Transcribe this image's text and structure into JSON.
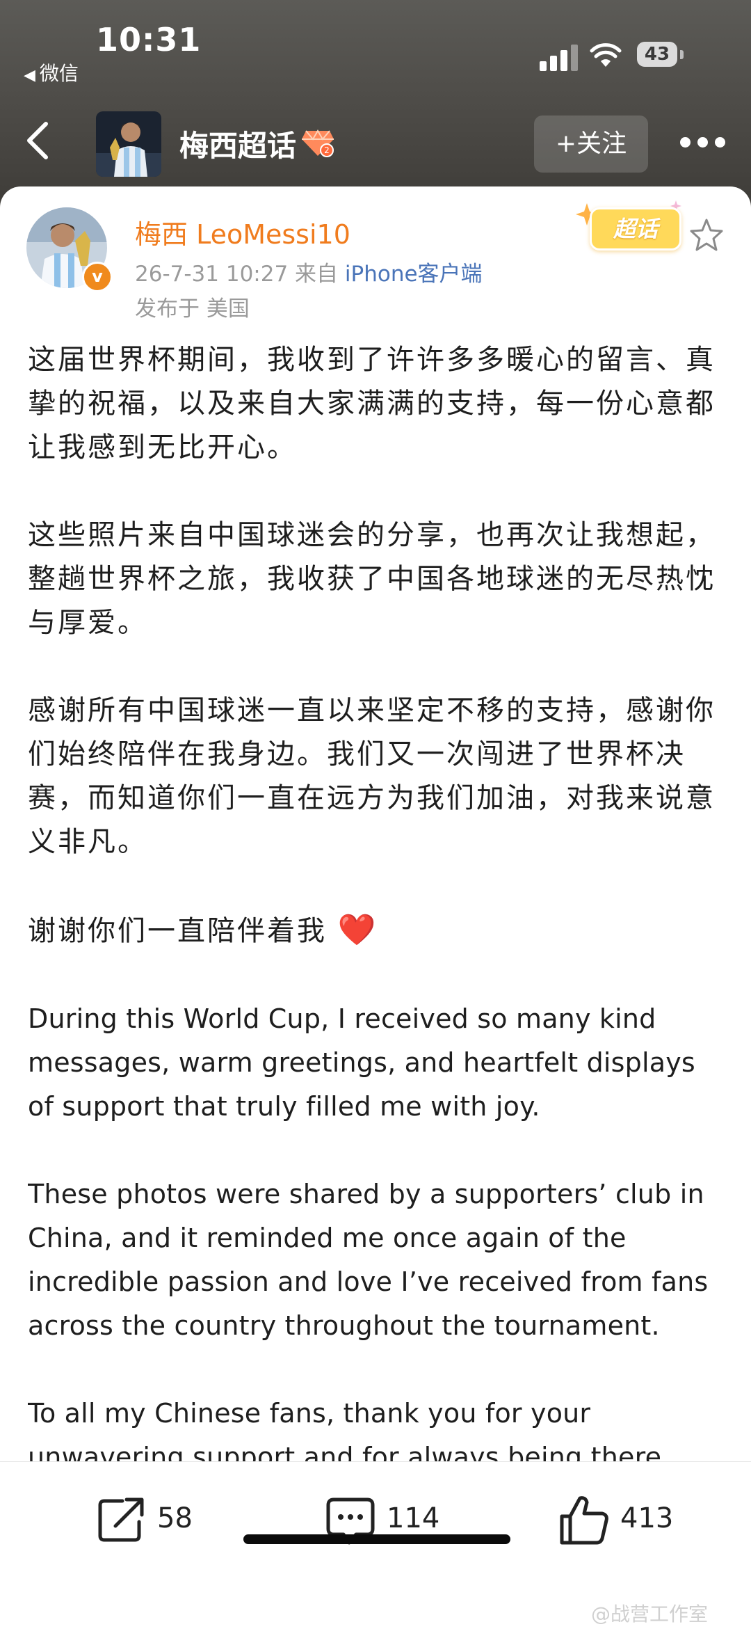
{
  "status_bar": {
    "time": "10:31",
    "back_app": "微信",
    "battery": "43"
  },
  "nav": {
    "title": "梅西超话",
    "follow_label": "+关注"
  },
  "post": {
    "author": "梅西 LeoMessi10",
    "date": "26-7-31 10:27",
    "from_prefix": "来自",
    "client": "iPhone客户端",
    "location": "发布于 美国",
    "topic_badge": "超话",
    "paragraphs": [
      "这届世界杯期间，我收到了许许多多暖心的留言、真挚的祝福，以及来自大家满满的支持，每一份心意都让我感到无比开心。",
      "这些照片来自中国球迷会的分享，也再次让我想起，整趟世界杯之旅，我收获了中国各地球迷的无尽热忱与厚爱。",
      "感谢所有中国球迷一直以来坚定不移的支持，感谢你们始终陪伴在我身边。我们又一次闯进了世界杯决赛，而知道你们一直在远方为我们加油，对我来说意义非凡。",
      "谢谢你们一直陪伴着我",
      "During this World Cup, I received so many kind messages, warm greetings, and heartfelt displays of support that truly filled me with joy.",
      "These photos were shared by a supporters’ club in China, and it reminded me once again of the incredible passion and love I’ve received from fans across the country throughout the tournament.",
      "To all my Chinese fans, thank you for your unwavering support and for always being there"
    ],
    "heart_emoji": "❤️"
  },
  "actions": {
    "repost_count": "58",
    "comment_count": "114",
    "like_count": "413"
  },
  "watermark": "@战营工作室",
  "colors": {
    "author_orange": "#f07c1e",
    "client_blue": "#4a74b8",
    "meta_gray": "#9a9a9a",
    "header_bg": "#4f4d49"
  }
}
